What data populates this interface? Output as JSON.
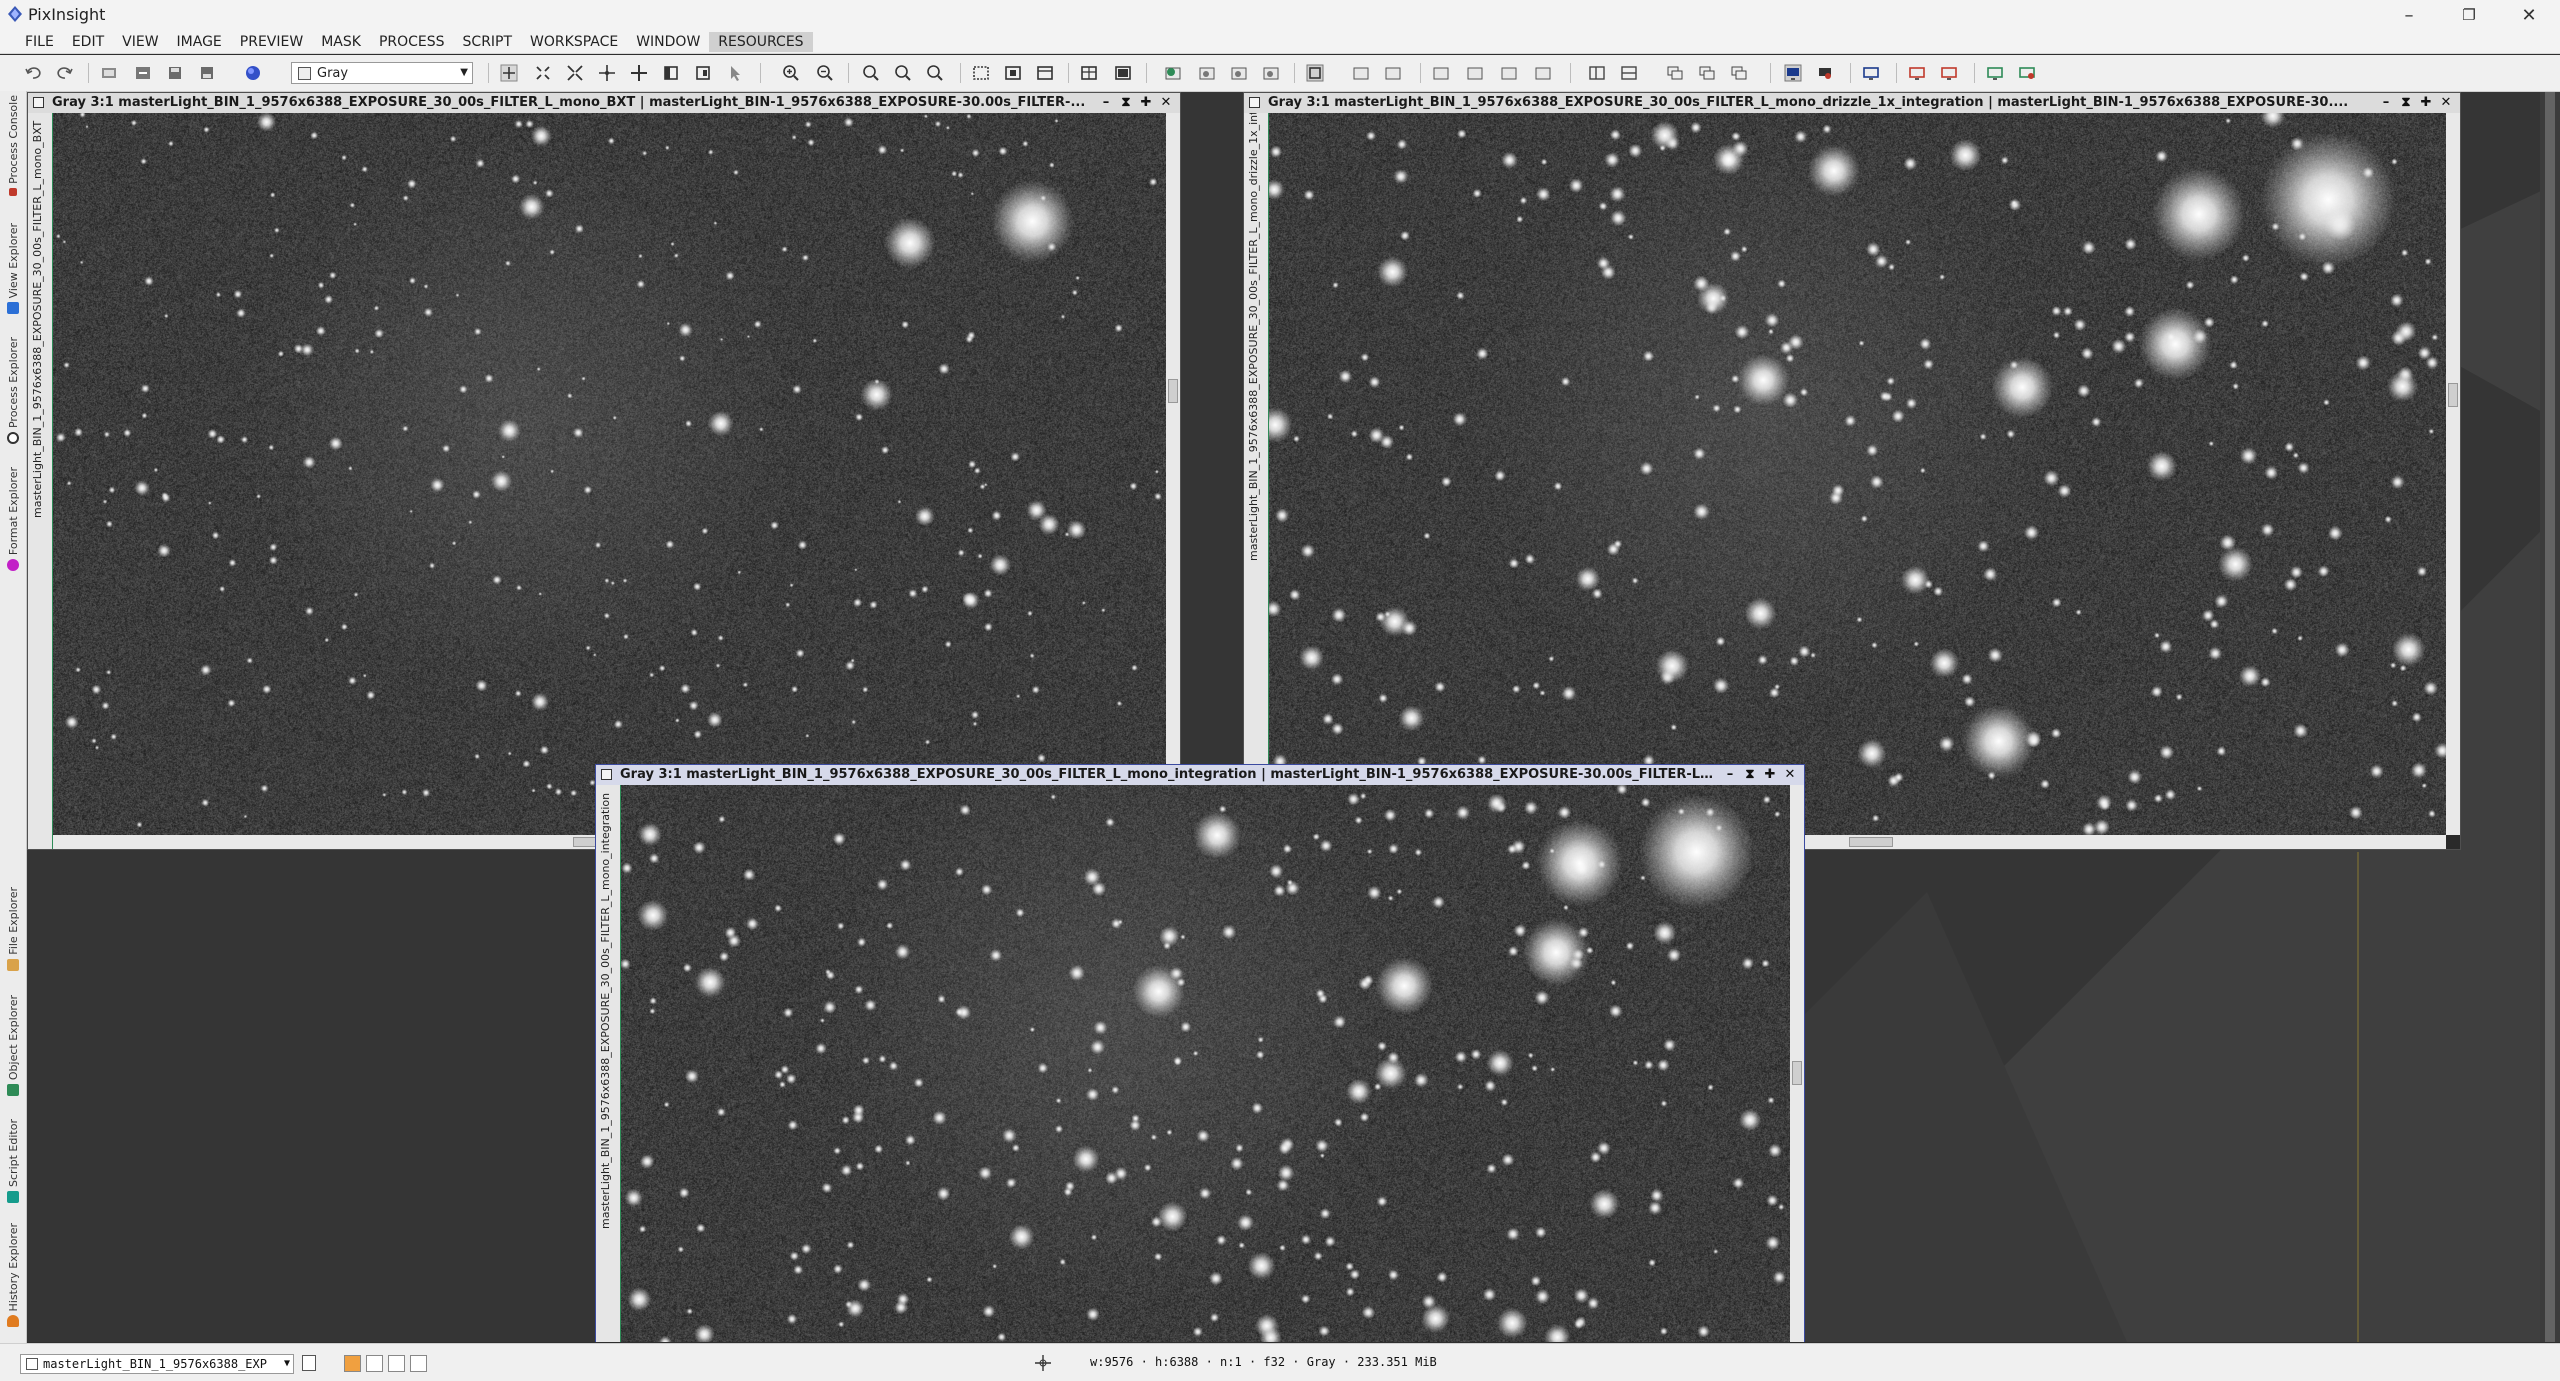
{
  "app": {
    "title": "PixInsight"
  },
  "menu": [
    "FILE",
    "EDIT",
    "VIEW",
    "IMAGE",
    "PREVIEW",
    "MASK",
    "PROCESS",
    "SCRIPT",
    "WORKSPACE",
    "WINDOW",
    "RESOURCES"
  ],
  "menu_active": "RESOURCES",
  "toolbar": {
    "colorspace": "Gray"
  },
  "dock_left": {
    "tabs_top": [
      "Process Console",
      "View Explorer",
      "Process Explorer",
      "Format Explorer"
    ],
    "tabs_bottom": [
      "File Explorer",
      "Object Explorer",
      "Script Editor",
      "History Explorer"
    ]
  },
  "windows": [
    {
      "title": "Gray 3:1 masterLight_BIN_1_9576x6388_EXPOSURE_30_00s_FILTER_L_mono_BXT | masterLight_BIN-1_9576x6388_EXPOSURE-30.00s_FILTER-...",
      "side_label": "masterLight_BIN_1_9576x6388_EXPOSURE_30_00s_FILTER_L_mono_BXT"
    },
    {
      "title": "Gray 3:1 masterLight_BIN_1_9576x6388_EXPOSURE_30_00s_FILTER_L_mono_drizzle_1x_integration | masterLight_BIN-1_9576x6388_EXPOSURE-30....",
      "side_label": "masterLight_BIN_1_9576x6388_EXPOSURE_30_00s_FILTER_L_mono_drizzle_1x_integration"
    },
    {
      "title": "Gray 3:1 masterLight_BIN_1_9576x6388_EXPOSURE_30_00s_FILTER_L_mono_integration | masterLight_BIN-1_9576x6388_EXPOSURE-30.00s_FILTER-L...",
      "side_label": "masterLight_BIN_1_9576x6388_EXPOSURE_30_00s_FILTER_L_mono_integration"
    }
  ],
  "status": {
    "view": "masterLight_BIN_1_9576x6388_EXP",
    "readout": "w:9576 · h:6388 · n:1 · f32 · Gray · 233.351 MiB"
  },
  "colors": {
    "dock_active_accent": "#2e8b57",
    "active_title": "#d6d9ea"
  }
}
